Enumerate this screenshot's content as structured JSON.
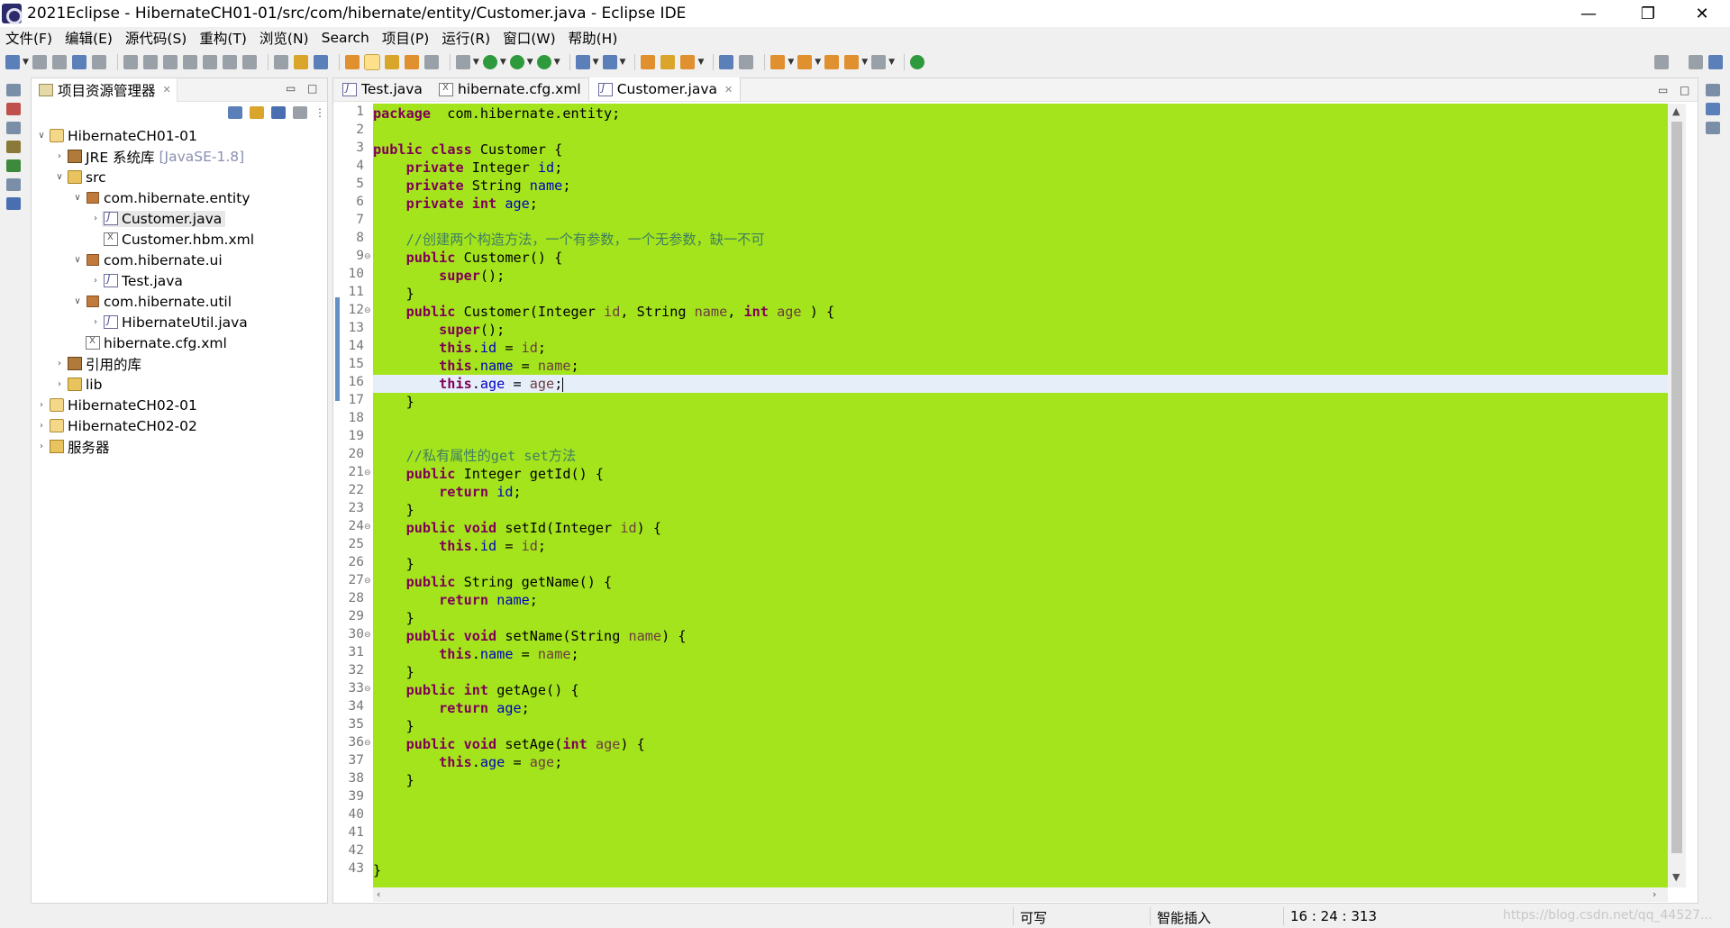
{
  "window": {
    "title": "2021Eclipse - HibernateCH01-01/src/com/hibernate/entity/Customer.java - Eclipse IDE",
    "minimize": "—",
    "maximize": "❐",
    "close": "✕"
  },
  "menubar": [
    "文件(F)",
    "编辑(E)",
    "源代码(S)",
    "重构(T)",
    "浏览(N)",
    "Search",
    "项目(P)",
    "运行(R)",
    "窗口(W)",
    "帮助(H)"
  ],
  "project_explorer": {
    "title": "项目资源管理器",
    "tree": [
      {
        "label": "HibernateCH01-01",
        "icon": "project-icon",
        "expanded": true
      },
      {
        "label": "JRE 系统库",
        "suffix": "[JavaSE-1.8]",
        "icon": "library-icon"
      },
      {
        "label": "src",
        "icon": "source-folder-icon",
        "expanded": true
      },
      {
        "label": "com.hibernate.entity",
        "icon": "package-icon",
        "expanded": true
      },
      {
        "label": "Customer.java",
        "icon": "java-file-icon",
        "selected": true
      },
      {
        "label": "Customer.hbm.xml",
        "icon": "xml-file-icon"
      },
      {
        "label": "com.hibernate.ui",
        "icon": "package-icon",
        "expanded": true
      },
      {
        "label": "Test.java",
        "icon": "java-file-icon"
      },
      {
        "label": "com.hibernate.util",
        "icon": "package-icon",
        "expanded": true
      },
      {
        "label": "HibernateUtil.java",
        "icon": "java-file-icon"
      },
      {
        "label": "hibernate.cfg.xml",
        "icon": "xml-file-icon"
      },
      {
        "label": "引用的库",
        "icon": "library-icon"
      },
      {
        "label": "lib",
        "icon": "folder-icon"
      },
      {
        "label": "HibernateCH02-01",
        "icon": "project-icon"
      },
      {
        "label": "HibernateCH02-02",
        "icon": "project-icon"
      },
      {
        "label": "服务器",
        "icon": "folder-icon"
      }
    ]
  },
  "editor": {
    "tabs": [
      {
        "label": "Test.java",
        "icon": "java-file-icon"
      },
      {
        "label": "hibernate.cfg.xml",
        "icon": "xml-file-icon"
      },
      {
        "label": "Customer.java",
        "icon": "java-file-icon",
        "active": true
      }
    ],
    "background": "#a4e41d",
    "current_line": 16,
    "lines": [
      [
        [
          "kw",
          "package"
        ],
        [
          "",
          "  com.hibernate.entity;"
        ]
      ],
      [],
      [
        [
          "kw",
          "public"
        ],
        [
          "",
          " "
        ],
        [
          "kw",
          "class"
        ],
        [
          "",
          " Customer {"
        ]
      ],
      [
        [
          "",
          "    "
        ],
        [
          "kw",
          "private"
        ],
        [
          "",
          " Integer "
        ],
        [
          "fld",
          "id"
        ],
        [
          "",
          ";"
        ]
      ],
      [
        [
          "",
          "    "
        ],
        [
          "kw",
          "private"
        ],
        [
          "",
          " String "
        ],
        [
          "fld",
          "name"
        ],
        [
          "",
          ";"
        ]
      ],
      [
        [
          "",
          "    "
        ],
        [
          "kw",
          "private"
        ],
        [
          "",
          " "
        ],
        [
          "kw",
          "int"
        ],
        [
          "",
          " "
        ],
        [
          "fld",
          "age"
        ],
        [
          "",
          ";"
        ]
      ],
      [],
      [
        [
          "",
          "    "
        ],
        [
          "cmt",
          "//创建两个构造方法，一个有参数，一个无参数，缺一不可"
        ]
      ],
      [
        [
          "",
          "    "
        ],
        [
          "kw",
          "public"
        ],
        [
          "",
          " Customer() {"
        ]
      ],
      [
        [
          "",
          "        "
        ],
        [
          "kw",
          "super"
        ],
        [
          "",
          "();"
        ]
      ],
      [
        [
          "",
          "    }"
        ]
      ],
      [
        [
          "",
          "    "
        ],
        [
          "kw",
          "public"
        ],
        [
          "",
          " Customer(Integer "
        ],
        [
          "prm",
          "id"
        ],
        [
          "",
          ", String "
        ],
        [
          "prm",
          "name"
        ],
        [
          "",
          ", "
        ],
        [
          "kw",
          "int"
        ],
        [
          "",
          " "
        ],
        [
          "prm",
          "age"
        ],
        [
          "",
          " ) {"
        ]
      ],
      [
        [
          "",
          "        "
        ],
        [
          "kw",
          "super"
        ],
        [
          "",
          "();"
        ]
      ],
      [
        [
          "",
          "        "
        ],
        [
          "kw",
          "this"
        ],
        [
          "",
          "."
        ],
        [
          "fld",
          "id"
        ],
        [
          "",
          " = "
        ],
        [
          "prm",
          "id"
        ],
        [
          "",
          ";"
        ]
      ],
      [
        [
          "",
          "        "
        ],
        [
          "kw",
          "this"
        ],
        [
          "",
          "."
        ],
        [
          "fld",
          "name"
        ],
        [
          "",
          " = "
        ],
        [
          "prm",
          "name"
        ],
        [
          "",
          ";"
        ]
      ],
      [
        [
          "",
          "        "
        ],
        [
          "kw",
          "this"
        ],
        [
          "",
          "."
        ],
        [
          "fld",
          "age"
        ],
        [
          "",
          " = "
        ],
        [
          "prm",
          "age"
        ],
        [
          "",
          ";"
        ]
      ],
      [
        [
          "",
          "    }"
        ]
      ],
      [],
      [],
      [
        [
          "",
          "    "
        ],
        [
          "cmt",
          "//私有属性的get set方法"
        ]
      ],
      [
        [
          "",
          "    "
        ],
        [
          "kw",
          "public"
        ],
        [
          "",
          " Integer getId() {"
        ]
      ],
      [
        [
          "",
          "        "
        ],
        [
          "kw",
          "return"
        ],
        [
          "",
          " "
        ],
        [
          "fld",
          "id"
        ],
        [
          "",
          ";"
        ]
      ],
      [
        [
          "",
          "    }"
        ]
      ],
      [
        [
          "",
          "    "
        ],
        [
          "kw",
          "public"
        ],
        [
          "",
          " "
        ],
        [
          "kw",
          "void"
        ],
        [
          "",
          " setId(Integer "
        ],
        [
          "prm",
          "id"
        ],
        [
          "",
          ") {"
        ]
      ],
      [
        [
          "",
          "        "
        ],
        [
          "kw",
          "this"
        ],
        [
          "",
          "."
        ],
        [
          "fld",
          "id"
        ],
        [
          "",
          " = "
        ],
        [
          "prm",
          "id"
        ],
        [
          "",
          ";"
        ]
      ],
      [
        [
          "",
          "    }"
        ]
      ],
      [
        [
          "",
          "    "
        ],
        [
          "kw",
          "public"
        ],
        [
          "",
          " String getName() {"
        ]
      ],
      [
        [
          "",
          "        "
        ],
        [
          "kw",
          "return"
        ],
        [
          "",
          " "
        ],
        [
          "fld",
          "name"
        ],
        [
          "",
          ";"
        ]
      ],
      [
        [
          "",
          "    }"
        ]
      ],
      [
        [
          "",
          "    "
        ],
        [
          "kw",
          "public"
        ],
        [
          "",
          " "
        ],
        [
          "kw",
          "void"
        ],
        [
          "",
          " setName(String "
        ],
        [
          "prm",
          "name"
        ],
        [
          "",
          ") {"
        ]
      ],
      [
        [
          "",
          "        "
        ],
        [
          "kw",
          "this"
        ],
        [
          "",
          "."
        ],
        [
          "fld",
          "name"
        ],
        [
          "",
          " = "
        ],
        [
          "prm",
          "name"
        ],
        [
          "",
          ";"
        ]
      ],
      [
        [
          "",
          "    }"
        ]
      ],
      [
        [
          "",
          "    "
        ],
        [
          "kw",
          "public"
        ],
        [
          "",
          " "
        ],
        [
          "kw",
          "int"
        ],
        [
          "",
          " getAge() {"
        ]
      ],
      [
        [
          "",
          "        "
        ],
        [
          "kw",
          "return"
        ],
        [
          "",
          " "
        ],
        [
          "fld",
          "age"
        ],
        [
          "",
          ";"
        ]
      ],
      [
        [
          "",
          "    }"
        ]
      ],
      [
        [
          "",
          "    "
        ],
        [
          "kw",
          "public"
        ],
        [
          "",
          " "
        ],
        [
          "kw",
          "void"
        ],
        [
          "",
          " setAge("
        ],
        [
          "kw",
          "int"
        ],
        [
          "",
          " "
        ],
        [
          "prm",
          "age"
        ],
        [
          "",
          ") {"
        ]
      ],
      [
        [
          "",
          "        "
        ],
        [
          "kw",
          "this"
        ],
        [
          "",
          "."
        ],
        [
          "fld",
          "age"
        ],
        [
          "",
          " = "
        ],
        [
          "prm",
          "age"
        ],
        [
          "",
          ";"
        ]
      ],
      [
        [
          "",
          "    }"
        ]
      ],
      [],
      [],
      [],
      [],
      [
        [
          "",
          "}"
        ]
      ]
    ],
    "fold_lines": [
      9,
      12,
      21,
      24,
      27,
      30,
      33,
      36
    ]
  },
  "statusbar": {
    "write_mode": "可写",
    "insert_mode": "智能插入",
    "position": "16 : 24 : 313",
    "watermark": "https://blog.csdn.net/qq_44527..."
  }
}
